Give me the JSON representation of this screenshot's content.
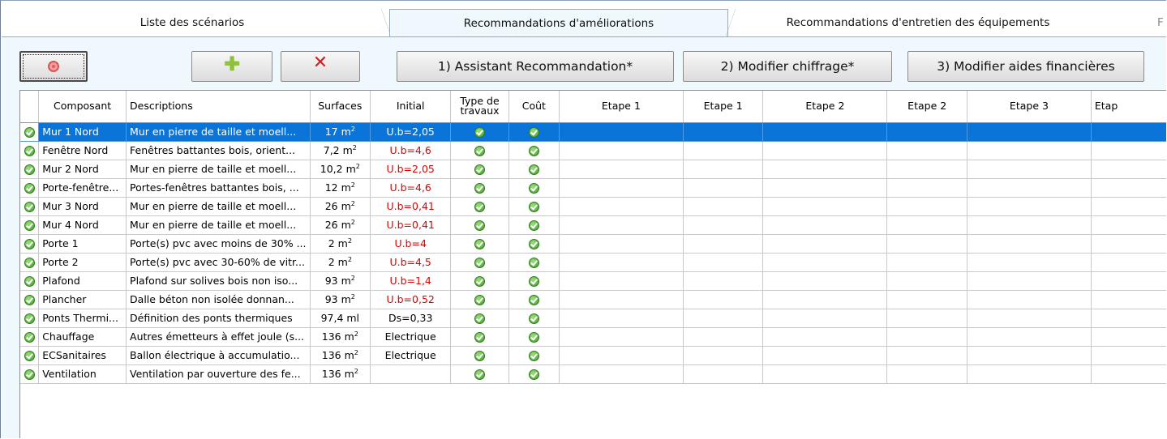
{
  "tabs": [
    {
      "label": "Liste des scénarios"
    },
    {
      "label": "Recommandations d'améliorations"
    },
    {
      "label": "Recommandations d'entretien des équipements"
    },
    {
      "label": "F"
    }
  ],
  "toolbar": {
    "settings_icon": "gear-icon",
    "add_icon": "plus-icon",
    "delete_icon": "close-icon",
    "assistant_label": "1) Assistant Recommandation*",
    "chiffrage_label": "2) Modifier chiffrage*",
    "aides_label": "3) Modifier aides financières"
  },
  "grid": {
    "headers": {
      "composant": "Composant",
      "descriptions": "Descriptions",
      "surfaces": "Surfaces",
      "initial": "Initial",
      "type_travaux": "Type de travaux",
      "cout": "Coût",
      "etape1a": "Etape 1",
      "etape1b": "Etape 1",
      "etape2a": "Etape 2",
      "etape2b": "Etape 2",
      "etape3a": "Etape 3",
      "etape3b": "Etap"
    },
    "rows": [
      {
        "composant": "Mur 1 Nord",
        "description": "Mur en pierre de taille et moell...",
        "surface": "17 m",
        "unit_sup": "2",
        "initial": "U.b=2,05",
        "initial_red": false
      },
      {
        "composant": "Fenêtre Nord",
        "description": "Fenêtres battantes bois, orient...",
        "surface": "7,2 m",
        "unit_sup": "2",
        "initial": "U.b=4,6",
        "initial_red": true
      },
      {
        "composant": "Mur 2 Nord",
        "description": "Mur en pierre de taille et moell...",
        "surface": "10,2 m",
        "unit_sup": "2",
        "initial": "U.b=2,05",
        "initial_red": true
      },
      {
        "composant": "Porte-fenêtre...",
        "description": "Portes-fenêtres battantes bois, ...",
        "surface": "12 m",
        "unit_sup": "2",
        "initial": "U.b=4,6",
        "initial_red": true
      },
      {
        "composant": "Mur 3 Nord",
        "description": "Mur en pierre de taille et moell...",
        "surface": "26 m",
        "unit_sup": "2",
        "initial": "U.b=0,41",
        "initial_red": true
      },
      {
        "composant": "Mur 4 Nord",
        "description": "Mur en pierre de taille et moell...",
        "surface": "26 m",
        "unit_sup": "2",
        "initial": "U.b=0,41",
        "initial_red": true
      },
      {
        "composant": "Porte 1",
        "description": "Porte(s) pvc avec moins de 30% ...",
        "surface": "2 m",
        "unit_sup": "2",
        "initial": "U.b=4",
        "initial_red": true
      },
      {
        "composant": "Porte 2",
        "description": "Porte(s) pvc avec 30-60% de vitr...",
        "surface": "2 m",
        "unit_sup": "2",
        "initial": "U.b=4,5",
        "initial_red": true
      },
      {
        "composant": "Plafond",
        "description": "Plafond sur solives bois non iso...",
        "surface": "93 m",
        "unit_sup": "2",
        "initial": "U.b=1,4",
        "initial_red": true
      },
      {
        "composant": "Plancher",
        "description": "Dalle béton non isolée donnan...",
        "surface": "93 m",
        "unit_sup": "2",
        "initial": "U.b=0,52",
        "initial_red": true
      },
      {
        "composant": "Ponts Thermi...",
        "description": "Définition des ponts thermiques",
        "surface": "97,4 ml",
        "unit_sup": "",
        "initial": "Ds=0,33",
        "initial_red": false
      },
      {
        "composant": "Chauffage",
        "description": "Autres émetteurs à effet joule (s...",
        "surface": "136 m",
        "unit_sup": "2",
        "initial": "Electrique",
        "initial_red": false
      },
      {
        "composant": "ECSanitaires",
        "description": "Ballon électrique à accumulatio...",
        "surface": "136 m",
        "unit_sup": "2",
        "initial": "Electrique",
        "initial_red": false
      },
      {
        "composant": "Ventilation",
        "description": "Ventilation par ouverture des fe...",
        "surface": "136 m",
        "unit_sup": "2",
        "initial": "",
        "initial_red": false
      }
    ]
  },
  "colors": {
    "selected_row": "#0a74d9",
    "error_text": "#e00000",
    "ok_icon": "#3f9a28",
    "tab_background": "#eef8fd"
  }
}
